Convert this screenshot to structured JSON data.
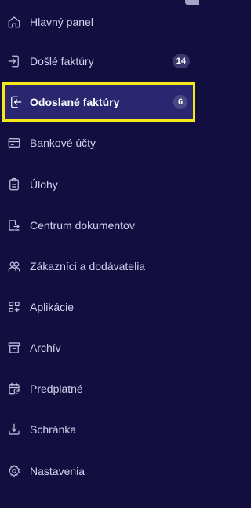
{
  "sidebar": {
    "items": [
      {
        "label": "Hlavný panel",
        "icon": "home-icon"
      },
      {
        "label": "Došlé faktúry",
        "icon": "inbox-arrow-icon",
        "badge": "14"
      },
      {
        "label": "Odoslané faktúry",
        "icon": "outbox-arrow-icon",
        "badge": "6",
        "active": true
      },
      {
        "label": "Bankové účty",
        "icon": "credit-card-icon"
      },
      {
        "label": "Úlohy",
        "icon": "clipboard-icon"
      },
      {
        "label": "Centrum dokumentov",
        "icon": "document-transfer-icon"
      },
      {
        "label": "Zákazníci a dodávatelia",
        "icon": "users-icon"
      },
      {
        "label": "Aplikácie",
        "icon": "apps-grid-icon"
      },
      {
        "label": "Archív",
        "icon": "archive-box-icon"
      },
      {
        "label": "Predplatné",
        "icon": "calendar-refresh-icon"
      },
      {
        "label": "Schránka",
        "icon": "tray-download-icon"
      },
      {
        "label": "Nastavenia",
        "icon": "gear-icon"
      }
    ]
  },
  "colors": {
    "background": "#120f40",
    "active_background": "#2a2770",
    "highlight_border": "#f3ea17",
    "badge_background": "#3b3870"
  }
}
